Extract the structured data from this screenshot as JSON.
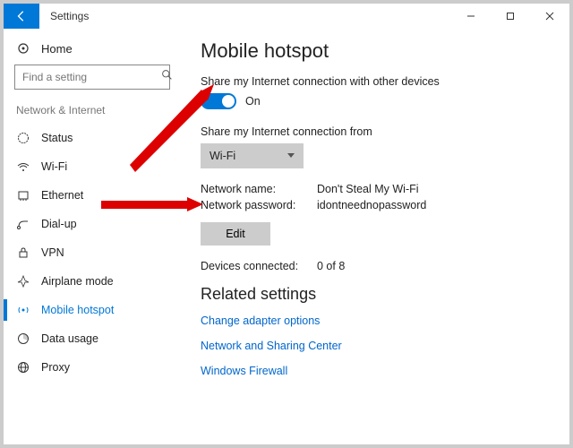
{
  "window": {
    "title": "Settings"
  },
  "sidebar": {
    "home": "Home",
    "search_placeholder": "Find a setting",
    "section": "Network & Internet",
    "items": [
      {
        "label": "Status"
      },
      {
        "label": "Wi-Fi"
      },
      {
        "label": "Ethernet"
      },
      {
        "label": "Dial-up"
      },
      {
        "label": "VPN"
      },
      {
        "label": "Airplane mode"
      },
      {
        "label": "Mobile hotspot"
      },
      {
        "label": "Data usage"
      },
      {
        "label": "Proxy"
      }
    ]
  },
  "main": {
    "title": "Mobile hotspot",
    "share_text": "Share my Internet connection with other devices",
    "toggle_state": "On",
    "share_from_label": "Share my Internet connection from",
    "share_from_value": "Wi-Fi",
    "network_name_label": "Network name:",
    "network_name_value": "Don't Steal My Wi-Fi",
    "network_password_label": "Network password:",
    "network_password_value": "idontneednopassword",
    "edit_button": "Edit",
    "devices_connected_label": "Devices connected:",
    "devices_connected_value": "0 of 8",
    "related_title": "Related settings",
    "links": {
      "adapter": "Change adapter options",
      "sharing": "Network and Sharing Center",
      "firewall": "Windows Firewall"
    }
  }
}
